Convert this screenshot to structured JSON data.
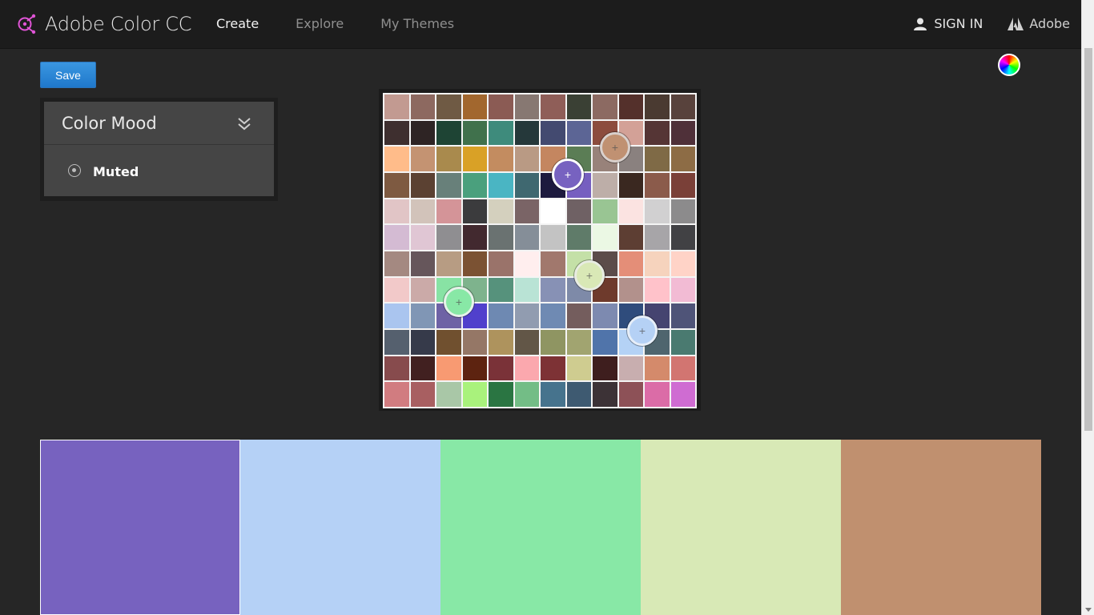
{
  "app": {
    "title": "Adobe Color CC",
    "logo_icon": "adobe-color-logo-icon"
  },
  "nav": [
    {
      "label": "Create",
      "active": true
    },
    {
      "label": "Explore",
      "active": false
    },
    {
      "label": "My Themes",
      "active": false
    }
  ],
  "header_right": {
    "signin_label": "SIGN IN",
    "adobe_label": "Adobe"
  },
  "toolbar": {
    "save_label": "Save"
  },
  "mood_panel": {
    "title": "Color Mood",
    "selected_option": "Muted"
  },
  "colors": {
    "accent": "#2a86d9",
    "background": "#262626",
    "topbar": "#1c1c1c"
  },
  "photo_grid": {
    "rows": [
      [
        "#c29a91",
        "#8d6960",
        "#6f5a44",
        "#a2672e",
        "#8b5b54",
        "#877872",
        "#8f5e58",
        "#3a4034",
        "#8c6a62",
        "#54302b",
        "#4a3a31",
        "#58423c"
      ],
      [
        "#3e2f2f",
        "#2e2424",
        "#1e4434",
        "#40714c",
        "#3e8b7c",
        "#25383a",
        "#434a70",
        "#5c6595",
        "#8c4c3e",
        "#d3a197",
        "#553535",
        "#4f3039"
      ],
      [
        "#ffbc8a",
        "#c49372",
        "#a98a4d",
        "#d9a126",
        "#c38c60",
        "#b99a84",
        "#c48660",
        "#5b7d55",
        "#98827a",
        "#8a817f",
        "#7f6a46",
        "#8d6c45"
      ],
      [
        "#7e5a41",
        "#5b4132",
        "#68807a",
        "#4aa07d",
        "#4ab5c3",
        "#3f6870",
        "#1d1a3e",
        "#765fc0",
        "#bdaea8",
        "#3a2820",
        "#8b5b4b",
        "#7a4038"
      ],
      [
        "#e1c5c6",
        "#d2c3ba",
        "#d49498",
        "#3b3b3d",
        "#d4d0be",
        "#7a6466",
        "#ffffff",
        "#6f6164",
        "#99c593",
        "#fbe3e1",
        "#d1d0d1",
        "#8c8b8c"
      ],
      [
        "#d4bbd3",
        "#e0c6d4",
        "#8f8e91",
        "#42292f",
        "#6a7271",
        "#858e98",
        "#c3c3c3",
        "#5f7b69",
        "#ebf8e4",
        "#5d3e33",
        "#a7a5a8",
        "#414144"
      ],
      [
        "#a48981",
        "#66565b",
        "#b79c83",
        "#7b5233",
        "#9a736a",
        "#ffeeee",
        "#a1786d",
        "#c4e0a7",
        "#5c4c4a",
        "#e48e78",
        "#f6d3bd",
        "#ffd3c7"
      ],
      [
        "#f2c9c9",
        "#cbaaa8",
        "#88e3a4",
        "#7eb38d",
        "#56927c",
        "#b9e3d5",
        "#8791b5",
        "#7e8aa8",
        "#6e3a2c",
        "#b2918c",
        "#ffc2ca",
        "#f2bbd4"
      ],
      [
        "#aac5ef",
        "#8096b5",
        "#6e62a5",
        "#5040cc",
        "#6e89b2",
        "#919cb0",
        "#6f8ab3",
        "#745d5d",
        "#7d8ab0",
        "#2f4c7c",
        "#454470",
        "#4f5478"
      ],
      [
        "#55606e",
        "#363a4a",
        "#70502f",
        "#957766",
        "#ae935d",
        "#625647",
        "#8f9562",
        "#a1a470",
        "#5074aa",
        "#b4d2f5",
        "#4f656e",
        "#4a7a70"
      ],
      [
        "#874b4d",
        "#412020",
        "#f89a72",
        "#5d2310",
        "#7a3238",
        "#fba8ae",
        "#7d3235",
        "#cfcc90",
        "#3e1e1e",
        "#c8aeaf",
        "#d48a6b",
        "#d27571"
      ],
      [
        "#d17c80",
        "#a85f61",
        "#a9c7a7",
        "#a9f27c",
        "#2a7542",
        "#73bd86",
        "#46738d",
        "#3e5a71",
        "#3c3236",
        "#8d5157",
        "#db6ca7",
        "#cf6cd2"
      ]
    ]
  },
  "markers": [
    {
      "color": "#7762c0",
      "ring": "#ffffff",
      "label": "+"
    },
    {
      "color": "#c09172",
      "ring": "#d9d0cc",
      "label": "+"
    },
    {
      "color": "#d9e8b6",
      "ring": "#e8ece2",
      "label": "+"
    },
    {
      "color": "#88e8a6",
      "ring": "#e6f2ea",
      "label": "+"
    },
    {
      "color": "#b5d1f5",
      "ring": "#e6eef8",
      "label": "+"
    }
  ],
  "theme_swatches": [
    {
      "hex": "#7762bf",
      "selected": true
    },
    {
      "hex": "#b5d1f6",
      "selected": false
    },
    {
      "hex": "#88e8a6",
      "selected": false
    },
    {
      "hex": "#d8e9b6",
      "selected": false
    },
    {
      "hex": "#c0906f",
      "selected": false
    }
  ]
}
